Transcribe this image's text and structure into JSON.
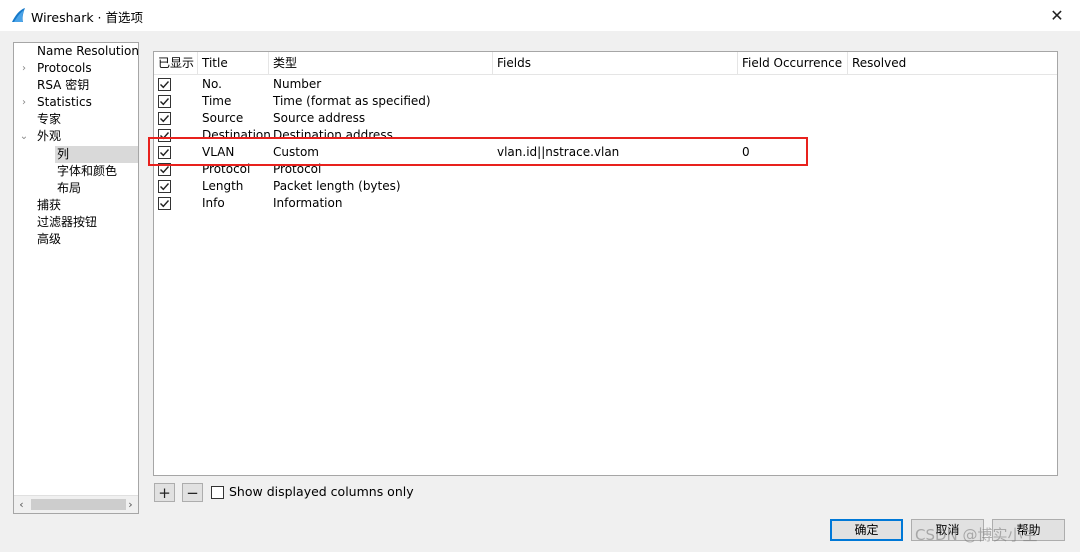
{
  "window": {
    "title": "Wireshark · 首选项",
    "close_glyph": "✕",
    "logo_icon": "wireshark-fin-icon"
  },
  "sidebar": {
    "items": [
      {
        "label": "Name Resolution"
      },
      {
        "label": "Protocols",
        "expander": "›"
      },
      {
        "label": "RSA 密钥"
      },
      {
        "label": "Statistics",
        "expander": "›"
      },
      {
        "label": "专家"
      },
      {
        "label": "外观",
        "expander": "⌄"
      },
      {
        "label": "列"
      },
      {
        "label": "字体和颜色"
      },
      {
        "label": "布局"
      },
      {
        "label": "捕获"
      },
      {
        "label": "过滤器按钮"
      },
      {
        "label": "高级"
      }
    ],
    "selected": "列",
    "scroll_left": "‹",
    "scroll_right": "›"
  },
  "columns_table": {
    "headers": [
      "已显示",
      "Title",
      "类型",
      "Fields",
      "Field Occurrence",
      "Resolved"
    ],
    "rows": [
      {
        "displayed": true,
        "title": "No.",
        "type": "Number",
        "fields": "",
        "occurrence": "",
        "resolved": ""
      },
      {
        "displayed": true,
        "title": "Time",
        "type": "Time (format as specified)",
        "fields": "",
        "occurrence": "",
        "resolved": ""
      },
      {
        "displayed": true,
        "title": "Source",
        "type": "Source address",
        "fields": "",
        "occurrence": "",
        "resolved": ""
      },
      {
        "displayed": true,
        "title": "Destination",
        "type": "Destination address",
        "fields": "",
        "occurrence": "",
        "resolved": ""
      },
      {
        "displayed": true,
        "title": "VLAN",
        "type": "Custom",
        "fields": "vlan.id||nstrace.vlan",
        "occurrence": "0",
        "resolved": ""
      },
      {
        "displayed": true,
        "title": "Protocol",
        "type": "Protocol",
        "fields": "",
        "occurrence": "",
        "resolved": ""
      },
      {
        "displayed": true,
        "title": "Length",
        "type": "Packet length (bytes)",
        "fields": "",
        "occurrence": "",
        "resolved": ""
      },
      {
        "displayed": true,
        "title": "Info",
        "type": "Information",
        "fields": "",
        "occurrence": "",
        "resolved": ""
      }
    ],
    "highlight_color": "#e8211d"
  },
  "controls": {
    "add_label": "+",
    "remove_label": "−",
    "show_displayed_label": "Show displayed columns only",
    "show_displayed_checked": false
  },
  "buttons": {
    "ok": "确定",
    "cancel": "取消",
    "help": "帮助"
  },
  "watermark": "CSDN @博实小生"
}
